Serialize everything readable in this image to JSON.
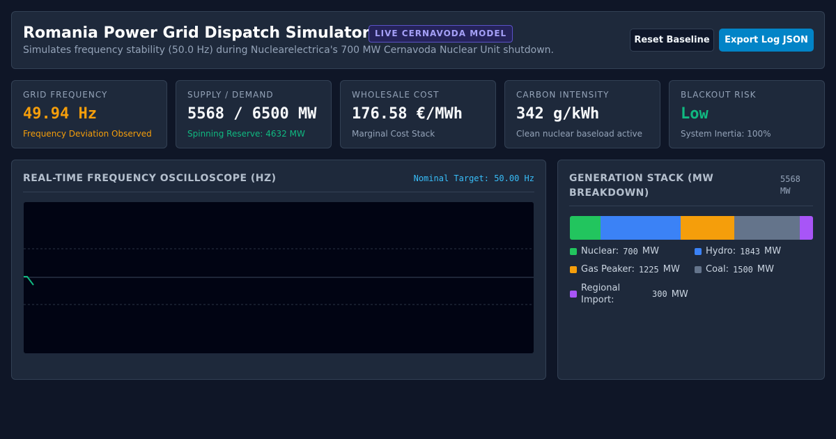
{
  "header": {
    "title": "Romania Power Grid Dispatch Simulator",
    "badge": "LIVE CERNAVODA MODEL",
    "subtitle": "Simulates frequency stability (50.0 Hz) during Nuclearelectrica's 700 MW Cernavoda Nuclear Unit shutdown.",
    "reset_label": "Reset Baseline",
    "export_label": "Export Log JSON"
  },
  "metrics": [
    {
      "label": "GRID FREQUENCY",
      "value": "49.94 Hz",
      "note": "Frequency Deviation Observed",
      "value_color": "#f59e0b",
      "note_color": "#f59e0b"
    },
    {
      "label": "SUPPLY / DEMAND",
      "value": "5568 / 6500 MW",
      "note": "Spinning Reserve: 4632 MW",
      "note_color": "#10b981"
    },
    {
      "label": "WHOLESALE COST",
      "value": "176.58 €/MWh",
      "note": "Marginal Cost Stack"
    },
    {
      "label": "CARBON INTENSITY",
      "value": "342 g/kWh",
      "note": "Clean nuclear baseload active"
    },
    {
      "label": "BLACKOUT RISK",
      "value": "Low",
      "note": "System Inertia: 100%",
      "value_color": "#10b981"
    }
  ],
  "oscilloscope": {
    "title": "REAL-TIME FREQUENCY OSCILLOSCOPE (HZ)",
    "target_label": "Nominal Target: 50.00 Hz",
    "line_color": "#10b981"
  },
  "generation": {
    "title": "GENERATION STACK (MW BREAKDOWN)",
    "total": "5568",
    "total_unit": "MW",
    "unit": "MW",
    "sources": [
      {
        "name": "Nuclear:",
        "value": 700,
        "color": "#22c55e"
      },
      {
        "name": "Hydro:",
        "value": 1843,
        "color": "#3b82f6"
      },
      {
        "name": "Gas Peaker:",
        "value": 1225,
        "color": "#f59e0b"
      },
      {
        "name": "Coal:",
        "value": 1500,
        "color": "#64748b"
      },
      {
        "name": "Regional Import:",
        "value": 300,
        "color": "#a855f7"
      }
    ]
  }
}
